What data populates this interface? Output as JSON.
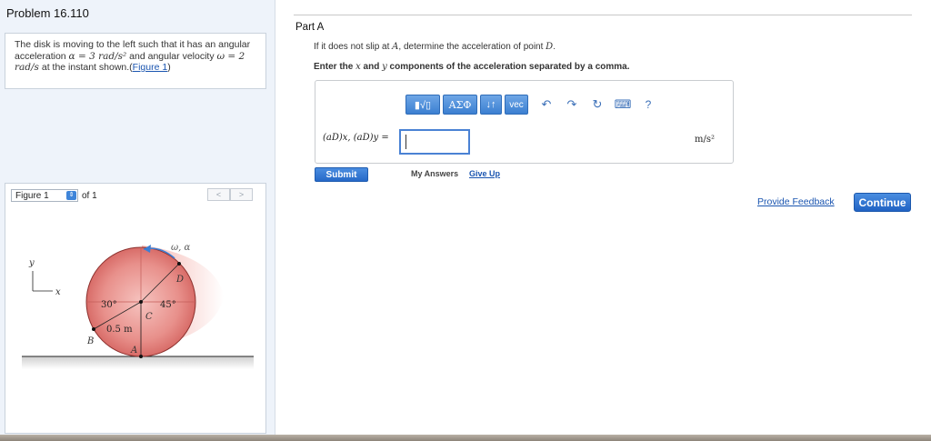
{
  "problem": {
    "title": "Problem 16.110",
    "text_1": "The disk is moving to the left such that it has an angular",
    "text_2a": "acceleration ",
    "text_2_alpha": "α = 3 rad/s²",
    "text_2b": " and angular velocity ",
    "text_2_omega": "ω = 2",
    "text_3_unit": "rad/s",
    "text_3b": " at the instant shown.(",
    "figure_link": "Figure 1",
    "text_3c": ")"
  },
  "figure": {
    "select_value": "Figure 1",
    "of_text": "of 1",
    "prev": "<",
    "next": ">",
    "labels": {
      "y": "y",
      "x": "x",
      "omega_alpha": "ω, α",
      "D": "D",
      "angle_30": "30°",
      "angle_45": "45°",
      "C": "C",
      "radius": "0.5 m",
      "B": "B",
      "A": "A"
    }
  },
  "part": {
    "label": "Part A",
    "question_a": "If it does not slip at ",
    "question_A": "A",
    "question_b": ", determine the acceleration of point ",
    "question_D": "D",
    "question_c": ".",
    "instruction_a": "Enter the ",
    "instruction_x": "x",
    "instruction_b": " and ",
    "instruction_y": "y",
    "instruction_c": " components of the acceleration separated by a comma."
  },
  "answer": {
    "toolbar": {
      "templates": "▮√▯",
      "greek": "ΑΣΦ",
      "arrows": "↓↑",
      "vec": "vec",
      "undo": "↶",
      "redo": "↷",
      "reset": "↻",
      "keyboard": "⌨",
      "help": "?"
    },
    "equation_label": "(aD)x, (aD)y =",
    "input_value": "",
    "unit": "m/s²"
  },
  "actions": {
    "submit": "Submit",
    "my_answers": "My Answers",
    "give_up": "Give Up",
    "feedback": "Provide Feedback",
    "continue": "Continue"
  },
  "colors": {
    "accent_blue": "#2f6cc8",
    "link": "#1a55b0",
    "disk": "#e07a76"
  }
}
